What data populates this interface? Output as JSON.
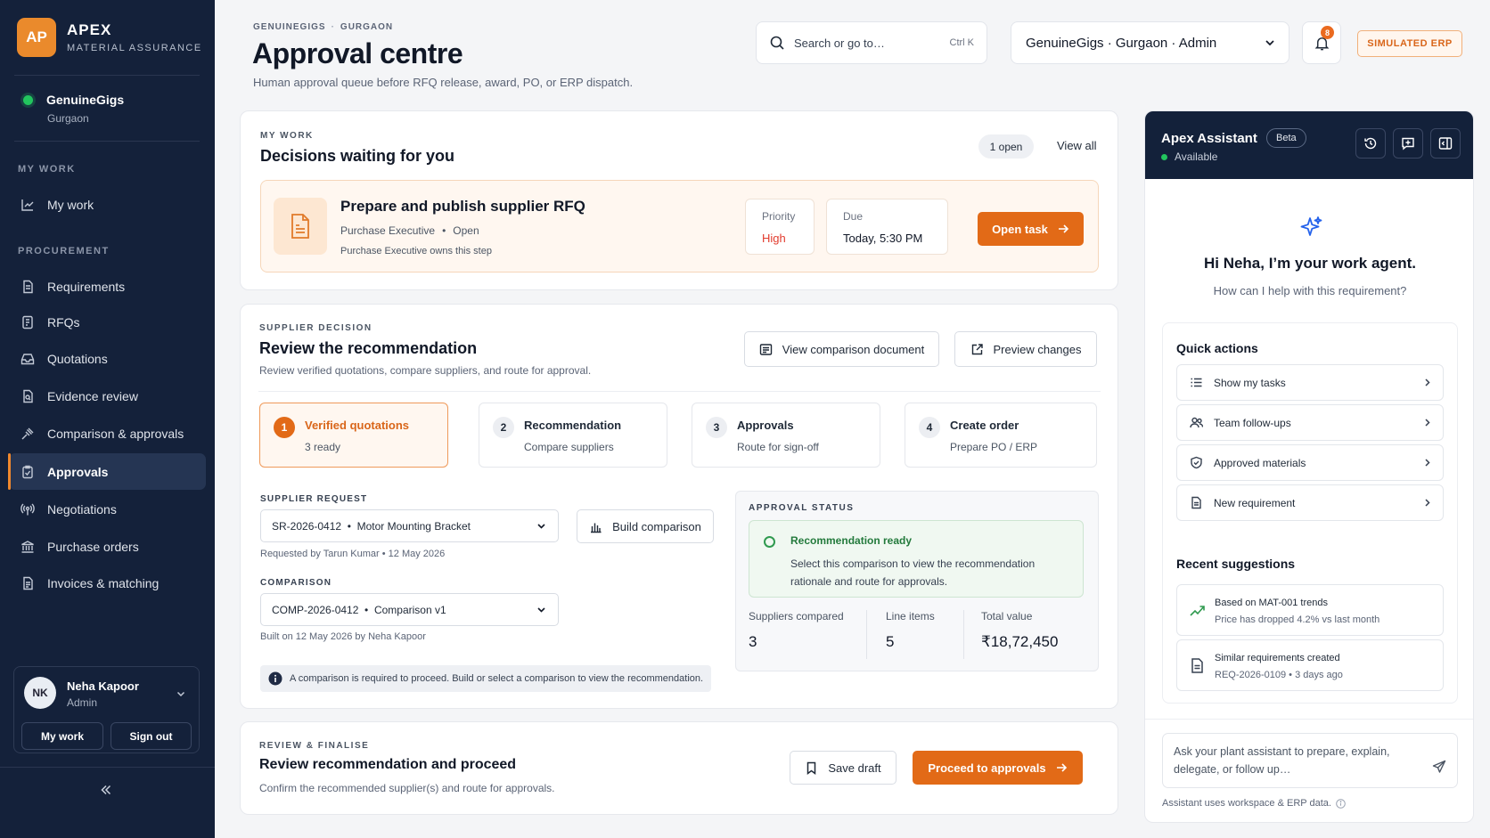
{
  "brand": {
    "logo": "AP",
    "name": "APEX",
    "sub": "MATERIAL ASSURANCE"
  },
  "workspace": {
    "name": "GenuineGigs",
    "location": "Gurgaon"
  },
  "nav": {
    "my_work_section": "MY WORK",
    "my_work": "My work",
    "procurement_section": "PROCUREMENT",
    "items": [
      {
        "label": "Requirements",
        "icon": "requirements-icon"
      },
      {
        "label": "RFQs",
        "icon": "rfq-icon"
      },
      {
        "label": "Quotations",
        "icon": "inbox-icon"
      },
      {
        "label": "Evidence review",
        "icon": "evidence-icon"
      },
      {
        "label": "Comparison & approvals",
        "icon": "gavel-icon"
      },
      {
        "label": "Approvals",
        "icon": "clipboard-check-icon",
        "active": true
      },
      {
        "label": "Negotiations",
        "icon": "broadcast-icon"
      },
      {
        "label": "Purchase orders",
        "icon": "bank-icon"
      },
      {
        "label": "Invoices & matching",
        "icon": "invoice-icon"
      }
    ]
  },
  "user": {
    "initials": "NK",
    "name": "Neha Kapoor",
    "role": "Admin",
    "my_work": "My work",
    "sign_out": "Sign out"
  },
  "header": {
    "breadcrumb": [
      "GENUINEGIGS",
      "GURGAON"
    ],
    "title": "Approval centre",
    "subtitle": "Human approval queue before RFQ release, award, PO, or ERP dispatch.",
    "search_placeholder": "Search or go to…",
    "search_shortcut": "Ctrl K",
    "workspace_select": "GenuineGigs · Gurgaon · Admin",
    "notifications": "8",
    "simulated_badge": "SIMULATED ERP"
  },
  "my_work": {
    "eyebrow": "MY WORK",
    "title": "Decisions waiting for you",
    "open_count": "1 open",
    "view_all": "View all",
    "task": {
      "title": "Prepare and publish supplier RFQ",
      "role": "Purchase Executive",
      "status": "Open",
      "owner": "Purchase Executive owns this step",
      "priority_label": "Priority",
      "priority_value": "High",
      "due_label": "Due",
      "due_value": "Today, 5:30 PM",
      "open_button": "Open task"
    }
  },
  "supplier_decision": {
    "eyebrow": "SUPPLIER DECISION",
    "title": "Review the recommendation",
    "subtitle": "Review verified quotations, compare suppliers, and route for approval.",
    "view_doc_button": "View comparison document",
    "preview_button": "Preview changes",
    "steps": [
      {
        "num": "1",
        "title": "Verified quotations",
        "sub": "3 ready"
      },
      {
        "num": "2",
        "title": "Recommendation",
        "sub": "Compare suppliers"
      },
      {
        "num": "3",
        "title": "Approvals",
        "sub": "Route for sign-off"
      },
      {
        "num": "4",
        "title": "Create order",
        "sub": "Prepare PO / ERP"
      }
    ],
    "supplier_request_label": "SUPPLIER REQUEST",
    "supplier_request_id": "SR-2026-0412",
    "supplier_request_name": "Motor Mounting Bracket",
    "supplier_request_hint": "Requested by Tarun Kumar • 12 May 2026",
    "build_button": "Build comparison",
    "comparison_label": "COMPARISON",
    "comparison_id": "COMP-2026-0412",
    "comparison_name": "Comparison v1",
    "comparison_hint": "Built on 12 May 2026 by Neha Kapoor",
    "info": "A comparison is required to proceed. Build or select a comparison to view the recommendation.",
    "approval_status": {
      "label": "APPROVAL STATUS",
      "title": "Recommendation ready",
      "text": "Select this comparison to view the recommendation rationale and route for approvals.",
      "metrics": [
        {
          "label": "Suppliers compared",
          "value": "3"
        },
        {
          "label": "Line items",
          "value": "5"
        },
        {
          "label": "Total value",
          "value": "₹18,72,450"
        }
      ]
    }
  },
  "finalise": {
    "eyebrow": "REVIEW & FINALISE",
    "title": "Review recommendation and proceed",
    "subtitle": "Confirm the recommended supplier(s) and route for approvals.",
    "save_draft": "Save draft",
    "proceed": "Proceed to approvals"
  },
  "assistant": {
    "title": "Apex Assistant",
    "beta": "Beta",
    "status": "Available",
    "greeting": "Hi Neha, I’m your work agent.",
    "greeting_sub": "How can I help with this requirement?",
    "quick_actions_title": "Quick actions",
    "quick_actions": [
      {
        "label": "Show my tasks",
        "icon": "list-icon"
      },
      {
        "label": "Team follow-ups",
        "icon": "users-icon"
      },
      {
        "label": "Approved materials",
        "icon": "shield-check-icon"
      },
      {
        "label": "New requirement",
        "icon": "document-icon"
      }
    ],
    "recent_title": "Recent suggestions",
    "recent": [
      {
        "main": "Based on MAT-001 trends",
        "sub": "Price has dropped 4.2% vs last month",
        "icon": "trend-icon"
      },
      {
        "main": "Similar requirements created",
        "sub": "REQ-2026-0109  •  3 days ago",
        "icon": "document-icon"
      }
    ],
    "ask_placeholder": "Ask your plant assistant to prepare, explain, delegate, or follow up…",
    "note": "Assistant uses workspace & ERP data."
  },
  "colors": {
    "accent": "#e26a17",
    "sidebar": "#14213a",
    "success": "#2f9a4f",
    "danger": "#e23b2d"
  }
}
